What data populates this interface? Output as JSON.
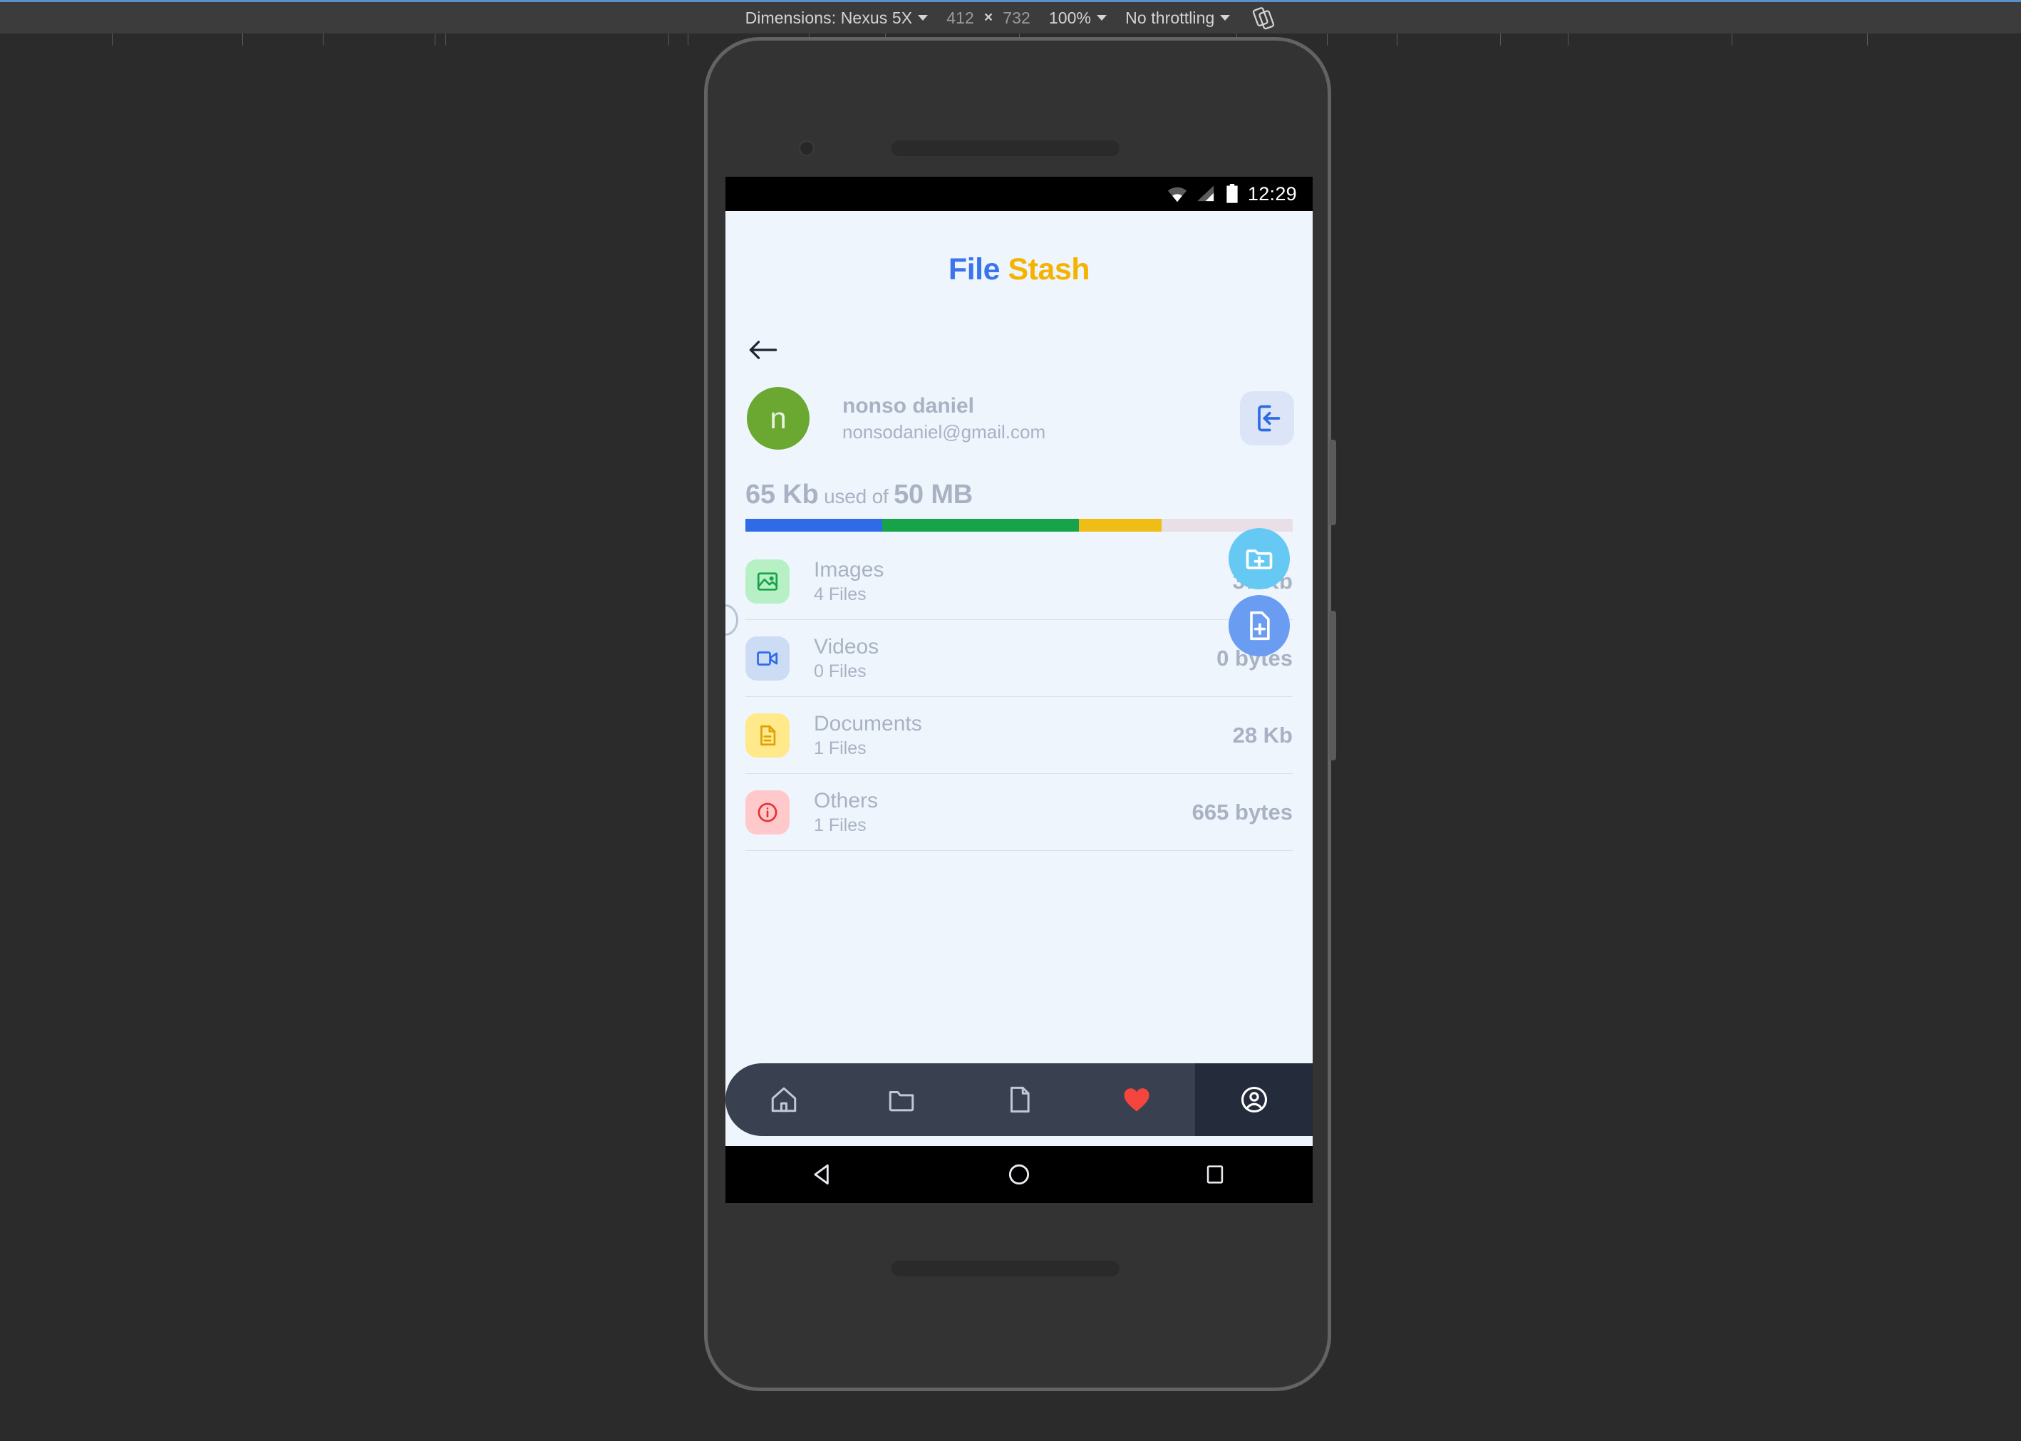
{
  "devtools": {
    "dimensions_label": "Dimensions: Nexus 5X",
    "width_value": "412",
    "multiply_symbol": "×",
    "height_value": "732",
    "zoom_value": "100%",
    "throttling_value": "No throttling",
    "rotate_icon": "rotate-icon"
  },
  "status_bar": {
    "time": "12:29",
    "icons": [
      "wifi-icon",
      "cell-signal-icon",
      "battery-icon"
    ]
  },
  "app": {
    "title_part1": "File",
    "title_part2": "Stash",
    "title_color1": "#3b74ec",
    "title_color2": "#f5b301",
    "background": "#eff5fd"
  },
  "nav": {
    "back_icon": "back-arrow-icon"
  },
  "profile": {
    "avatar_initial": "n",
    "avatar_color": "#6aa832",
    "name": "nonso daniel",
    "email": "nonsodaniel@gmail.com",
    "logout_icon": "logout-icon",
    "logout_bg": "#dbe5f7",
    "logout_icon_color": "#2f6be6"
  },
  "storage": {
    "used": "65 Kb",
    "used_of_label": "used of",
    "total": "50 MB",
    "segments": [
      {
        "name": "images",
        "color": "#2f6be6",
        "percent": 25
      },
      {
        "name": "videos",
        "color": "#16a34a",
        "percent": 36
      },
      {
        "name": "documents",
        "color": "#f0bc16",
        "percent": 15
      },
      {
        "name": "free",
        "color": "#e9dfe6",
        "percent": 24
      }
    ]
  },
  "categories": [
    {
      "name": "Images",
      "files": "4 Files",
      "size": "37 Kb",
      "icon": "image-icon",
      "icon_bg": "#b6f0c4",
      "icon_color": "#18a24a"
    },
    {
      "name": "Videos",
      "files": "0 Files",
      "size": "0 bytes",
      "icon": "video-camera-icon",
      "icon_bg": "#ccdcf5",
      "icon_color": "#2f6be6"
    },
    {
      "name": "Documents",
      "files": "1 Files",
      "size": "28 Kb",
      "icon": "document-icon",
      "icon_bg": "#ffe98a",
      "icon_color": "#e0a106"
    },
    {
      "name": "Others",
      "files": "1 Files",
      "size": "665 bytes",
      "icon": "info-circle-icon",
      "icon_bg": "#ffc8ca",
      "icon_color": "#e8302f"
    }
  ],
  "fabs": [
    {
      "name": "add-folder",
      "icon": "folder-plus-icon",
      "color": "#66c9f4"
    },
    {
      "name": "add-file",
      "icon": "file-plus-icon",
      "color": "#6a9cf2"
    }
  ],
  "bottom_nav": {
    "background": "#39404f",
    "active_background": "#242b3a",
    "items": [
      {
        "name": "home",
        "icon": "home-icon",
        "active": false,
        "color": "#c3c9d4"
      },
      {
        "name": "folders",
        "icon": "folder-icon",
        "active": false,
        "color": "#c3c9d4"
      },
      {
        "name": "files",
        "icon": "file-icon",
        "active": false,
        "color": "#c3c9d4"
      },
      {
        "name": "favorites",
        "icon": "heart-icon",
        "active": false,
        "color": "#f5453f"
      },
      {
        "name": "profile",
        "icon": "user-circle-icon",
        "active": true,
        "color": "#ffffff"
      }
    ]
  },
  "android_nav": {
    "back": "triangle-back-icon",
    "home": "circle-home-icon",
    "recents": "square-recents-icon"
  }
}
